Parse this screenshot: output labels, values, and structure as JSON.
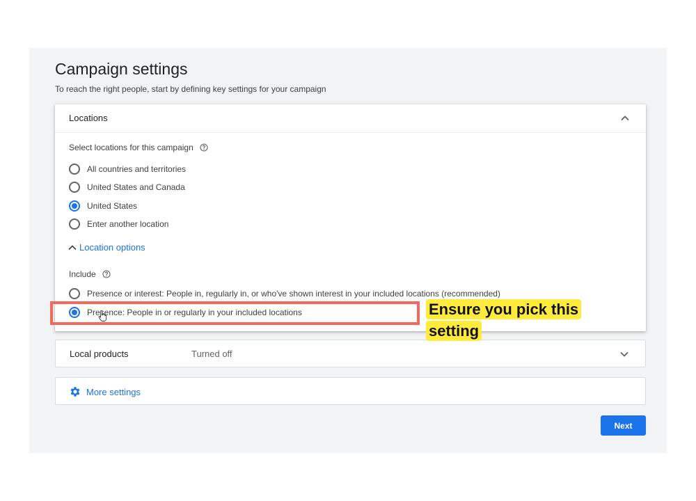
{
  "page": {
    "title": "Campaign settings",
    "subtitle": "To reach the right people, start by defining key settings for your campaign"
  },
  "locations": {
    "header": "Locations",
    "select_label": "Select locations for this campaign",
    "options": [
      {
        "label": "All countries and territories",
        "checked": false
      },
      {
        "label": "United States and Canada",
        "checked": false
      },
      {
        "label": "United States",
        "checked": true
      },
      {
        "label": "Enter another location",
        "checked": false
      }
    ],
    "location_options_label": "Location options",
    "include_label": "Include",
    "include_options": [
      {
        "label": "Presence or interest: People in, regularly in, or who've shown interest in your included locations (recommended)",
        "checked": false
      },
      {
        "label": "Presence: People in or regularly in your included locations",
        "checked": true
      }
    ]
  },
  "local_products": {
    "title": "Local products",
    "status": "Turned off"
  },
  "more_settings": {
    "label": "More settings"
  },
  "actions": {
    "next_label": "Next"
  },
  "annotation": {
    "callout_line1": "Ensure you pick this",
    "callout_line2": "setting"
  },
  "colors": {
    "accent": "#1a73e8",
    "highlight_border": "#f0695a",
    "callout_bg": "#ffeb3b",
    "background": "#f1f3f4"
  }
}
